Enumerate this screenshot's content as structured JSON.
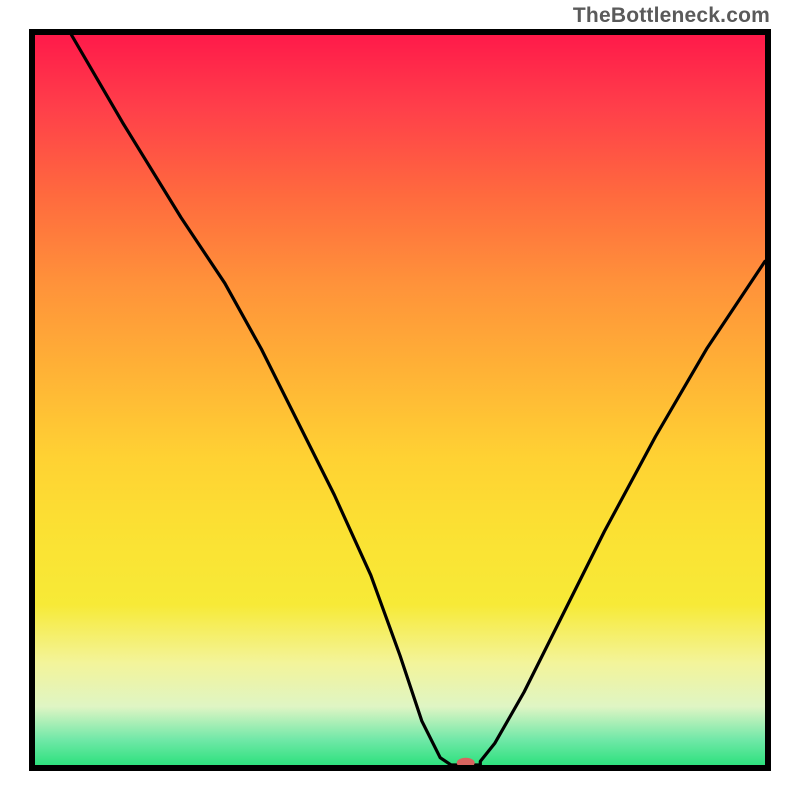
{
  "watermark": "TheBottleneck.com",
  "chart_data": {
    "type": "line",
    "title": "",
    "xlabel": "",
    "ylabel": "",
    "xlim": [
      0,
      100
    ],
    "ylim": [
      0,
      100
    ],
    "grid": false,
    "legend": false,
    "series": [
      {
        "name": "left-branch",
        "x": [
          5,
          12,
          20,
          26,
          31,
          36,
          41,
          46,
          50,
          53,
          55.5,
          57
        ],
        "y": [
          100,
          88,
          75,
          66,
          57,
          47,
          37,
          26,
          15,
          6,
          1,
          0
        ]
      },
      {
        "name": "flat-segment",
        "x": [
          57,
          61
        ],
        "y": [
          0,
          0
        ]
      },
      {
        "name": "right-branch",
        "x": [
          61,
          63,
          67,
          72,
          78,
          85,
          92,
          100
        ],
        "y": [
          0.5,
          3,
          10,
          20,
          32,
          45,
          57,
          69
        ]
      }
    ],
    "marker": {
      "x": 59,
      "y": 0.3
    }
  },
  "colors": {
    "border": "#000000",
    "curve": "#000000",
    "marker": "#d8645f"
  }
}
